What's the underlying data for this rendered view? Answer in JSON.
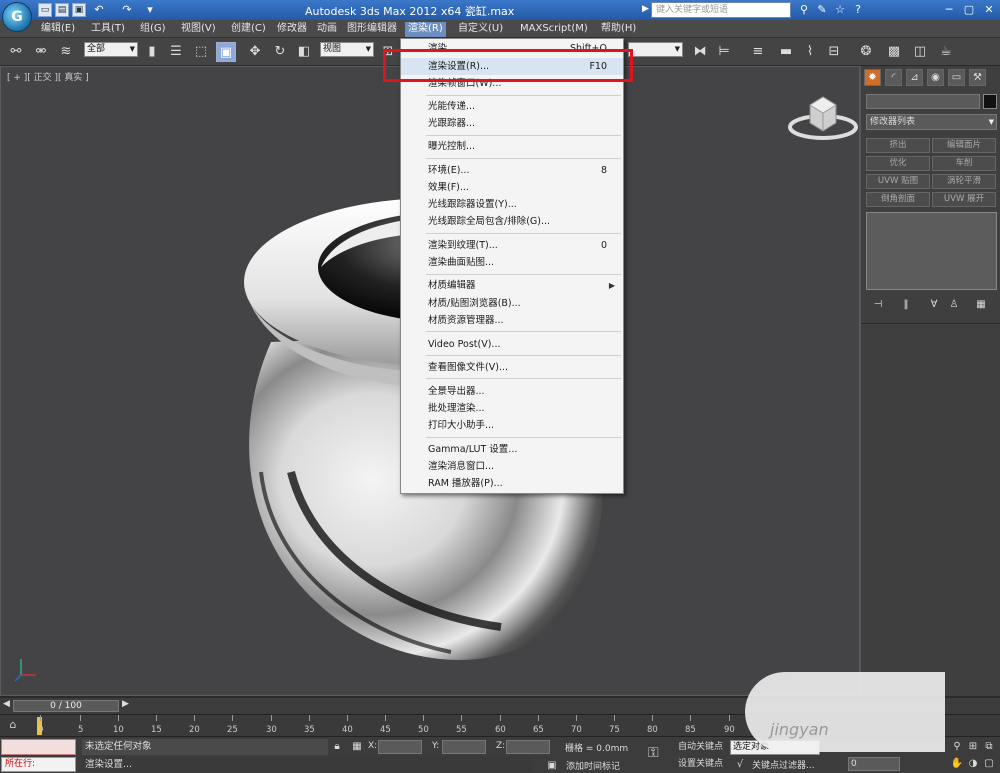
{
  "titlebar": {
    "title": "Autodesk 3ds Max  2012 x64     瓷缸.max",
    "search_placeholder": "键入关键字或短语"
  },
  "menubar": {
    "items": [
      "编辑(E)",
      "工具(T)",
      "组(G)",
      "视图(V)",
      "创建(C)",
      "修改器",
      "动画",
      "图形编辑器",
      "渲染(R)",
      "自定义(U)",
      "MAXScript(M)",
      "帮助(H)"
    ]
  },
  "toolbar": {
    "selection_filter": "全部",
    "ref_coord": "视图"
  },
  "viewport": {
    "label": "[ + ][ 正交 ][ 真实 ]"
  },
  "render_menu": {
    "items": [
      {
        "label": "渲染",
        "shortcut": "Shift+Q"
      },
      {
        "label": "渲染设置(R)...",
        "shortcut": "F10"
      },
      {
        "label": "渲染帧窗口(W)...",
        "shortcut": ""
      },
      {
        "label": "光能传递...",
        "shortcut": ""
      },
      {
        "label": "光跟踪器...",
        "shortcut": ""
      },
      {
        "label": "曝光控制...",
        "shortcut": ""
      },
      {
        "label": "环境(E)...",
        "shortcut": "8"
      },
      {
        "label": "效果(F)...",
        "shortcut": ""
      },
      {
        "label": "光线跟踪器设置(Y)...",
        "shortcut": ""
      },
      {
        "label": "光线跟踪全局包含/排除(G)...",
        "shortcut": ""
      },
      {
        "label": "渲染到纹理(T)...",
        "shortcut": "0"
      },
      {
        "label": "渲染曲面贴图...",
        "shortcut": ""
      },
      {
        "label": "材质编辑器",
        "shortcut": ""
      },
      {
        "label": "材质/贴图浏览器(B)...",
        "shortcut": ""
      },
      {
        "label": "材质资源管理器...",
        "shortcut": ""
      },
      {
        "label": "Video Post(V)...",
        "shortcut": ""
      },
      {
        "label": "查看图像文件(V)...",
        "shortcut": ""
      },
      {
        "label": "全景导出器...",
        "shortcut": ""
      },
      {
        "label": "批处理渲染...",
        "shortcut": ""
      },
      {
        "label": "打印大小助手...",
        "shortcut": ""
      },
      {
        "label": "Gamma/LUT 设置...",
        "shortcut": ""
      },
      {
        "label": "渲染消息窗口...",
        "shortcut": ""
      },
      {
        "label": "RAM 播放器(P)...",
        "shortcut": ""
      }
    ]
  },
  "cmdpanel": {
    "modifier_list": "修改器列表",
    "buttons": [
      "挤出",
      "编辑面片",
      "优化",
      "车削",
      "UVW 贴图",
      "涡轮平滑",
      "倒角剖面",
      "UVW 展开"
    ]
  },
  "timeline": {
    "slider": "0 / 100",
    "ticks": [
      "0",
      "5",
      "10",
      "15",
      "20",
      "25",
      "30",
      "35",
      "40",
      "45",
      "50",
      "55",
      "60",
      "65",
      "70",
      "75",
      "80",
      "85",
      "90"
    ]
  },
  "statusbar": {
    "maxscript": "所在行:",
    "selection": "未选定任何对象",
    "prompt": "渲染设置...",
    "x_label": "X:",
    "y_label": "Y:",
    "z_label": "Z:",
    "grid": "栅格 = 0.0mm",
    "add_time_tag": "添加时间标记",
    "auto_key": "自动关键点",
    "set_key": "设置关键点",
    "selected": "选定对象",
    "key_filters": "关键点过滤器...",
    "frame": "0"
  },
  "watermark": "jingyan"
}
